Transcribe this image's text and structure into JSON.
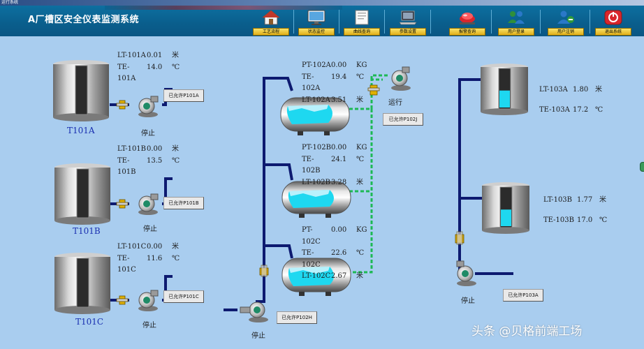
{
  "window": {
    "caption": "运行系统"
  },
  "header": {
    "title": "A厂槽区安全仪表监测系统",
    "toolbar": [
      {
        "id": "process",
        "label": "工艺流程",
        "icon": "house-icon"
      },
      {
        "id": "status",
        "label": "状态监控",
        "icon": "monitor-icon"
      },
      {
        "id": "curve",
        "label": "曲线查询",
        "icon": "document-icon"
      },
      {
        "id": "params",
        "label": "参数设置",
        "icon": "laptop-icon"
      },
      {
        "id": "alarm",
        "label": "报警查询",
        "icon": "siren-icon"
      },
      {
        "id": "login",
        "label": "用户登录",
        "icon": "users-icon"
      },
      {
        "id": "logout",
        "label": "用户注销",
        "icon": "user-logout-icon"
      },
      {
        "id": "exit",
        "label": "退出系统",
        "icon": "power-icon"
      }
    ]
  },
  "tanks_left": [
    {
      "name": "T101A",
      "lt_tag": "LT-101A",
      "lt_val": "0.01",
      "lt_unit": "米",
      "te_tag": "TE-101A",
      "te_val": "14.0",
      "te_unit": "℃",
      "pump_status": "停止",
      "permit": "已允许P101A"
    },
    {
      "name": "T101B",
      "lt_tag": "LT-101B",
      "lt_val": "0.00",
      "lt_unit": "米",
      "te_tag": "TE-101B",
      "te_val": "13.5",
      "te_unit": "℃",
      "pump_status": "停止",
      "permit": "已允许P101B"
    },
    {
      "name": "T101C",
      "lt_tag": "LT-101C",
      "lt_val": "0.00",
      "lt_unit": "米",
      "te_tag": "TE-101C",
      "te_val": "11.6",
      "te_unit": "℃",
      "pump_status": "停止",
      "permit": "已允许P101C"
    }
  ],
  "vessels_middle": [
    {
      "pt_tag": "PT-102A",
      "pt_val": "0.00",
      "pt_unit": "KG",
      "te_tag": "TE-102A",
      "te_val": "19.4",
      "te_unit": "℃",
      "lt_tag": "LT-102A",
      "lt_val": "3.51",
      "lt_unit": "米"
    },
    {
      "pt_tag": "PT-102B",
      "pt_val": "0.00",
      "pt_unit": "KG",
      "te_tag": "TE-102B",
      "te_val": "24.1",
      "te_unit": "℃",
      "lt_tag": "LT-102B",
      "lt_val": "3.28",
      "lt_unit": "米"
    },
    {
      "pt_tag": "PT-102C",
      "pt_val": "0.00",
      "pt_unit": "KG",
      "te_tag": "TE-102C",
      "te_val": "22.6",
      "te_unit": "℃",
      "lt_tag": "LT-102C",
      "lt_val": "2.67",
      "lt_unit": "米"
    }
  ],
  "middle_pumps": {
    "top_status": "运行",
    "top_permit": "已允许P102J",
    "bottom_status": "停止",
    "bottom_permit": "已允许P102H"
  },
  "tanks_right": [
    {
      "lt_tag": "LT-103A",
      "lt_val": "1.80",
      "lt_unit": "米",
      "te_tag": "TE-103A",
      "te_val": "17.2",
      "te_unit": "℃",
      "level": 0.45
    },
    {
      "lt_tag": "LT-103B",
      "lt_val": "1.77",
      "lt_unit": "米",
      "te_tag": "TE-103B",
      "te_val": "17.0",
      "te_unit": "℃",
      "level": 0.44
    }
  ],
  "right_pump": {
    "status": "停止",
    "permit": "已允许P103A"
  },
  "watermark": "头条 @贝格前端工场",
  "colors": {
    "background": "#a9cdef",
    "pipe": "#0d1a70",
    "running_line": "#1db954",
    "liquid": "#1ed8f0",
    "tank_level_dark": "#2b2b2b"
  }
}
